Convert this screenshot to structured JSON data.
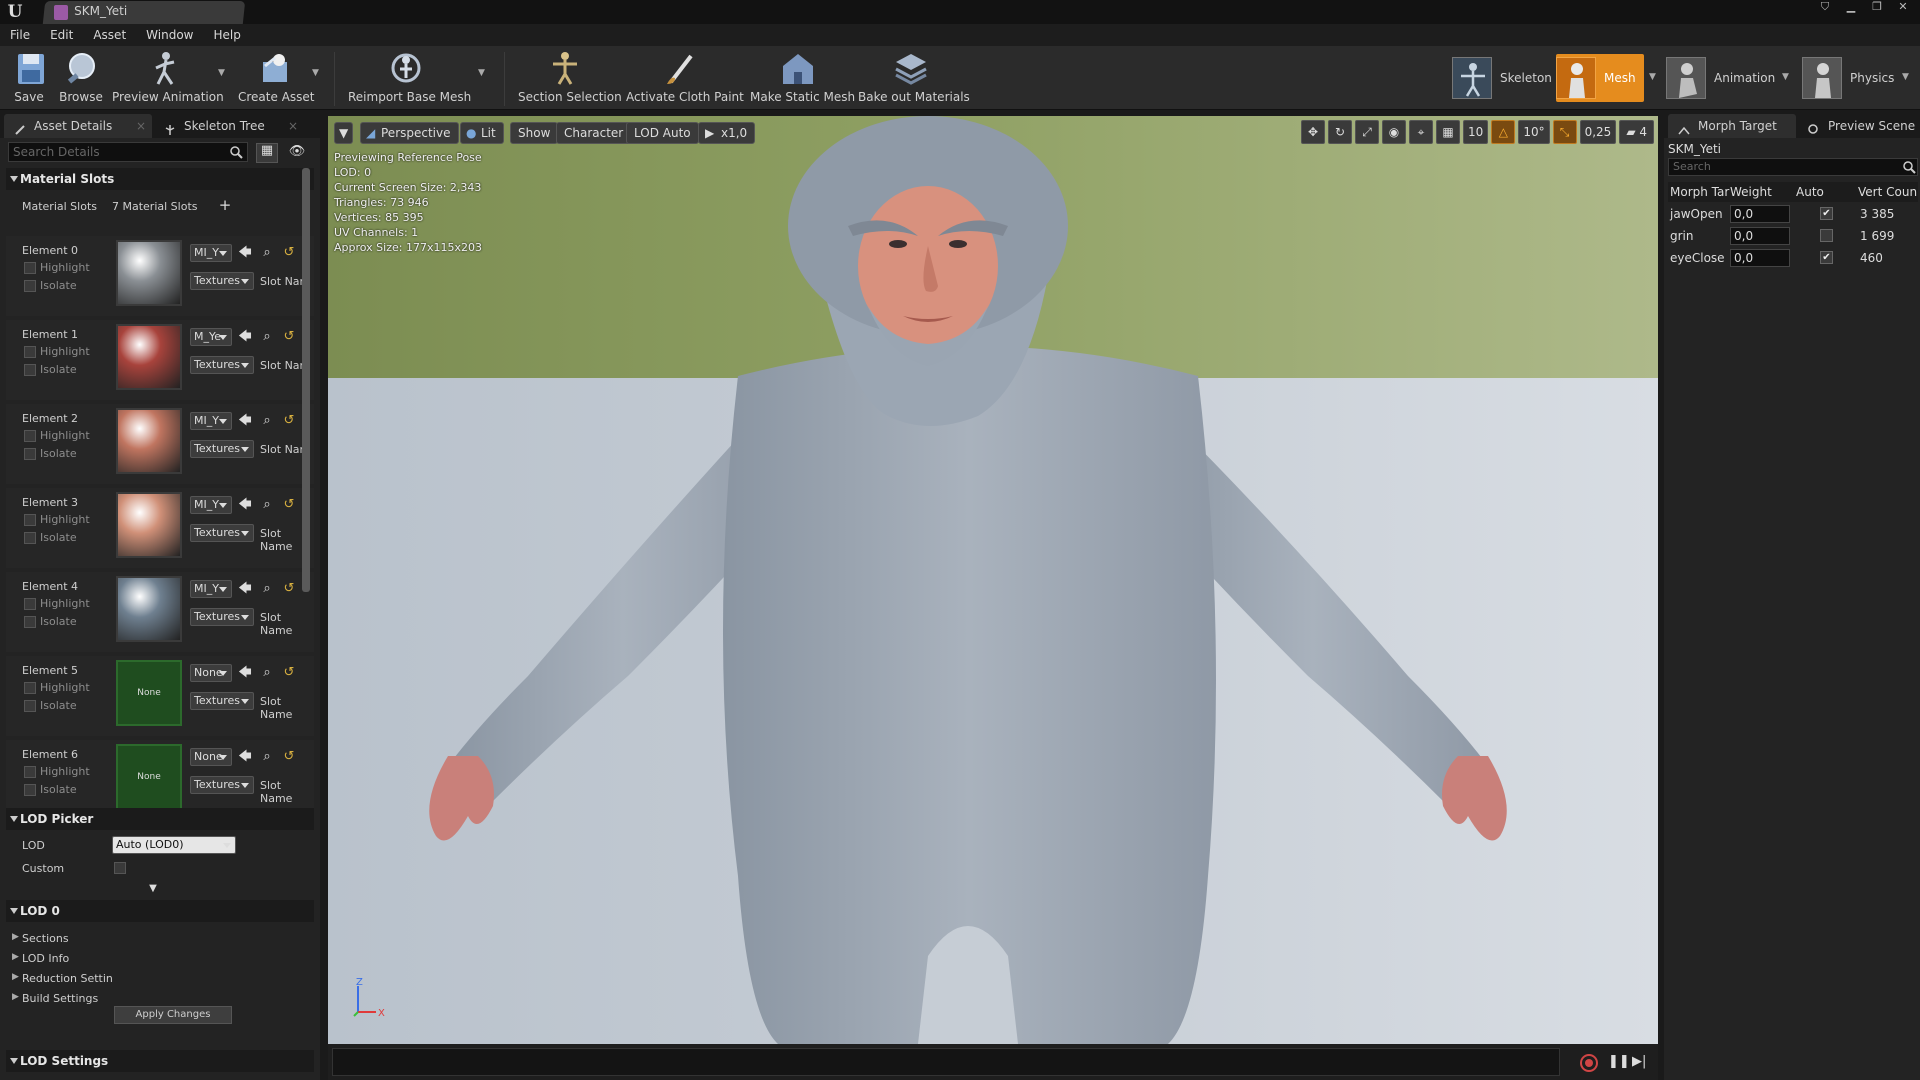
{
  "window": {
    "doc_tab": "SKM_Yeti"
  },
  "menu": [
    "File",
    "Edit",
    "Asset",
    "Window",
    "Help"
  ],
  "toolbar": {
    "save": "Save",
    "browse": "Browse",
    "preview_animation": "Preview Animation",
    "create_asset": "Create Asset",
    "reimport": "Reimport Base Mesh",
    "section_selection": "Section Selection",
    "cloth_paint": "Activate Cloth Paint",
    "static_mesh": "Make Static Mesh",
    "bake_materials": "Bake out Materials"
  },
  "modes": {
    "skeleton": "Skeleton",
    "mesh": "Mesh",
    "animation": "Animation",
    "physics": "Physics",
    "active": "Mesh"
  },
  "left_panel": {
    "tabs": [
      "Asset Details",
      "Skeleton Tree"
    ],
    "search_placeholder": "Search Details",
    "material_slots_header": "Material Slots",
    "material_slots_label": "Material Slots",
    "material_slots_count": "7 Material Slots",
    "elements": [
      {
        "label": "Element 0",
        "material": "MI_Y",
        "textures": "Textures",
        "slot": "Slot Nam",
        "thumb": "#8a8f94",
        "highlight": "Highlight",
        "isolate": "Isolate"
      },
      {
        "label": "Element 1",
        "material": "M_Ye",
        "textures": "Textures",
        "slot": "Slot Nam",
        "thumb": "#a8433c",
        "highlight": "Highlight",
        "isolate": "Isolate"
      },
      {
        "label": "Element 2",
        "material": "MI_Y",
        "textures": "Textures",
        "slot": "Slot Nam",
        "thumb": "#c07560",
        "highlight": "Highlight",
        "isolate": "Isolate"
      },
      {
        "label": "Element 3",
        "material": "MI_Y",
        "textures": "Textures",
        "slot": "Slot Name",
        "thumb": "#d09078",
        "highlight": "Highlight",
        "isolate": "Isolate"
      },
      {
        "label": "Element 4",
        "material": "MI_Y",
        "textures": "Textures",
        "slot": "Slot Name",
        "thumb": "#6f8090",
        "highlight": "Highlight",
        "isolate": "Isolate"
      },
      {
        "label": "Element 5",
        "material": "None",
        "textures": "Textures",
        "slot": "Slot Name",
        "thumb_text": "None",
        "highlight": "Highlight",
        "isolate": "Isolate"
      },
      {
        "label": "Element 6",
        "material": "None",
        "textures": "Textures",
        "slot": "Slot Name",
        "thumb_text": "None",
        "highlight": "Highlight",
        "isolate": "Isolate"
      }
    ],
    "lod_picker_header": "LOD Picker",
    "lod_label": "LOD",
    "lod_value": "Auto (LOD0)",
    "custom_label": "Custom",
    "lod0_header": "LOD 0",
    "lod0_items": [
      "Sections",
      "LOD Info",
      "Reduction Settin",
      "Build Settings"
    ],
    "apply_changes": "Apply Changes",
    "lod_settings_header": "LOD Settings"
  },
  "viewport": {
    "buttons": {
      "perspective": "Perspective",
      "lit": "Lit",
      "show": "Show",
      "character": "Character",
      "lod": "LOD Auto",
      "speed": "x1,0"
    },
    "info": [
      "Previewing Reference Pose",
      "LOD: 0",
      "Current Screen Size: 2,343",
      "Triangles: 73 946",
      "Vertices: 85 395",
      "UV Channels: 1",
      "Approx Size: 177x115x203"
    ],
    "right_tools": {
      "grid": "10",
      "angle": "10°",
      "scale": "0,25",
      "camera_speed": "4"
    },
    "axis": {
      "x": "X",
      "z": "Z"
    }
  },
  "right_panel": {
    "tabs": [
      "Morph Target",
      "Preview Scene"
    ],
    "asset_name": "SKM_Yeti",
    "search_placeholder": "Search",
    "columns": [
      "Morph Tar",
      "Weight",
      "Auto",
      "Vert Coun"
    ],
    "rows": [
      {
        "name": "jawOpen",
        "weight": "0,0",
        "auto": true,
        "verts": "3 385"
      },
      {
        "name": "grin",
        "weight": "0,0",
        "auto": false,
        "verts": "1 699"
      },
      {
        "name": "eyeClose",
        "weight": "0,0",
        "auto": true,
        "verts": "460"
      }
    ]
  },
  "colors": {
    "accent": "#e58c1e",
    "bg": "#232323",
    "fur": "#9aa6b4",
    "skin": "#d8917e"
  }
}
